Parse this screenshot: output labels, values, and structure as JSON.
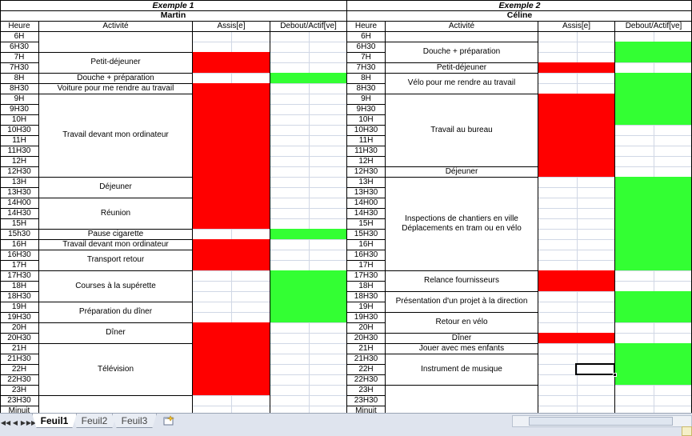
{
  "sheet": {
    "example1": {
      "title": "Exemple 1",
      "name": "Martin"
    },
    "example2": {
      "title": "Exemple 2",
      "name": "Céline"
    },
    "headers": {
      "hour": "Heure",
      "activity": "Activité",
      "seated": "Assis[e]",
      "standing": "Debout/Actif[ve]"
    },
    "hours_left": [
      "6H",
      "6H30",
      "7H",
      "7H30",
      "8H",
      "8H30",
      "9H",
      "9H30",
      "10H",
      "10H30",
      "11H",
      "11H30",
      "12H",
      "12H30",
      "13H",
      "13H30",
      "14H00",
      "14H30",
      "15H",
      "15h30",
      "16H",
      "16H30",
      "17H",
      "17H30",
      "18H",
      "18H30",
      "19H",
      "19H30",
      "20H",
      "20H30",
      "21H",
      "21H30",
      "22H",
      "22H30",
      "23H",
      "23H30",
      "Minuit"
    ],
    "hours_right": [
      "6H",
      "6H30",
      "7H",
      "7H30",
      "8H",
      "8H30",
      "9H",
      "9H30",
      "10H",
      "10H30",
      "11H",
      "11H30",
      "12H",
      "12H30",
      "13H",
      "13H30",
      "14H00",
      "14H30",
      "15H",
      "15H30",
      "16H",
      "16H30",
      "17H",
      "17H30",
      "18H",
      "18H30",
      "19H",
      "19H30",
      "20H",
      "20H30",
      "21H",
      "21H30",
      "22H",
      "22H30",
      "23H",
      "23H30",
      "Minuit"
    ],
    "activities_left": [
      {
        "label": "Petit-déjeuner",
        "start": 2,
        "end": 3
      },
      {
        "label": "Douche + préparation",
        "start": 4,
        "end": 4
      },
      {
        "label": "Voiture pour me rendre au travail",
        "start": 5,
        "end": 5
      },
      {
        "label": "Travail devant mon ordinateur",
        "start": 6,
        "end": 13
      },
      {
        "label": "Déjeuner",
        "start": 14,
        "end": 15
      },
      {
        "label": "Réunion",
        "start": 16,
        "end": 18
      },
      {
        "label": "Pause cigarette",
        "start": 19,
        "end": 19
      },
      {
        "label": "Travail devant mon ordinateur",
        "start": 20,
        "end": 20
      },
      {
        "label": "Transport retour",
        "start": 21,
        "end": 22
      },
      {
        "label": "Courses à la supérette",
        "start": 23,
        "end": 25
      },
      {
        "label": "Préparation du dîner",
        "start": 26,
        "end": 27
      },
      {
        "label": "Dîner",
        "start": 28,
        "end": 29
      },
      {
        "label": "Télévision",
        "start": 30,
        "end": 34
      }
    ],
    "activities_right": [
      {
        "label": "Douche + préparation",
        "start": 1,
        "end": 2
      },
      {
        "label": "Petit-déjeuner",
        "start": 3,
        "end": 3
      },
      {
        "label": "Vélo pour me rendre au travail",
        "start": 4,
        "end": 5
      },
      {
        "label": "Travail au bureau",
        "start": 6,
        "end": 12
      },
      {
        "label": "Déjeuner",
        "start": 13,
        "end": 13
      },
      {
        "label": "Inspections de chantiers en ville",
        "label2": "Déplacements en tram ou en vélo",
        "start": 14,
        "end": 22
      },
      {
        "label": "Relance fournisseurs",
        "start": 23,
        "end": 24
      },
      {
        "label": "Présentation d'un projet à la direction",
        "start": 25,
        "end": 26
      },
      {
        "label": "Retour en vélo",
        "start": 27,
        "end": 28
      },
      {
        "label": "Dîner",
        "start": 29,
        "end": 29
      },
      {
        "label": "Jouer avec mes enfants",
        "start": 30,
        "end": 30
      },
      {
        "label": "Instrument de musique",
        "start": 31,
        "end": 33
      }
    ],
    "fills_left": [
      {
        "col": "seated",
        "start": 2,
        "end": 3
      },
      {
        "col": "standing",
        "start": 4,
        "end": 4
      },
      {
        "col": "seated",
        "start": 5,
        "end": 18
      },
      {
        "col": "standing",
        "start": 19,
        "end": 19
      },
      {
        "col": "seated",
        "start": 20,
        "end": 22
      },
      {
        "col": "standing",
        "start": 23,
        "end": 27
      },
      {
        "col": "seated",
        "start": 28,
        "end": 34
      }
    ],
    "fills_right": [
      {
        "col": "standing",
        "start": 1,
        "end": 2
      },
      {
        "col": "seated",
        "start": 3,
        "end": 3
      },
      {
        "col": "standing",
        "start": 4,
        "end": 8
      },
      {
        "col": "seated",
        "start": 6,
        "end": 13
      },
      {
        "col": "standing",
        "start": 14,
        "end": 22
      },
      {
        "col": "seated",
        "start": 23,
        "end": 24
      },
      {
        "col": "standing",
        "start": 25,
        "end": 27
      },
      {
        "col": "seated",
        "start": 29,
        "end": 29
      },
      {
        "col": "standing",
        "start": 30,
        "end": 33
      }
    ],
    "colors": {
      "seated": "#ff0000",
      "standing": "#33ff33"
    }
  },
  "tabs": [
    "Feuil1",
    "Feuil2",
    "Feuil3"
  ],
  "active_tab": "Feuil1",
  "icons": {
    "nav_first": "first-sheet-icon",
    "nav_prev": "prev-sheet-icon",
    "nav_next": "next-sheet-icon",
    "nav_last": "last-sheet-icon",
    "new_sheet": "insert-sheet-icon"
  }
}
